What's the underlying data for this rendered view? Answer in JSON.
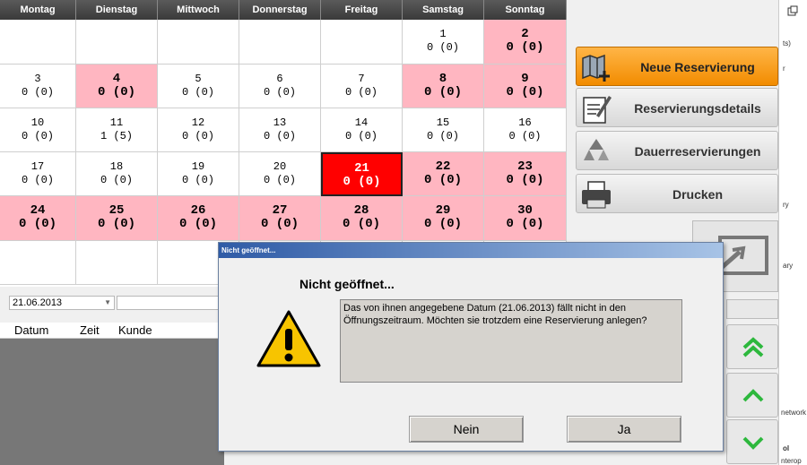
{
  "calendar": {
    "weekdays": [
      "Montag",
      "Dienstag",
      "Mittwoch",
      "Donnerstag",
      "Freitag",
      "Samstag",
      "Sonntag"
    ],
    "weeks": [
      [
        null,
        null,
        null,
        null,
        null,
        {
          "day": "1",
          "count": "0 (0)"
        },
        {
          "day": "2",
          "count": "0 (0)",
          "weekend": true
        }
      ],
      [
        {
          "day": "3",
          "count": "0 (0)"
        },
        {
          "day": "4",
          "count": "0 (0)",
          "weekend": true
        },
        {
          "day": "5",
          "count": "0 (0)"
        },
        {
          "day": "6",
          "count": "0 (0)"
        },
        {
          "day": "7",
          "count": "0 (0)"
        },
        {
          "day": "8",
          "count": "0 (0)",
          "weekend": true
        },
        {
          "day": "9",
          "count": "0 (0)",
          "weekend": true
        }
      ],
      [
        {
          "day": "10",
          "count": "0 (0)"
        },
        {
          "day": "11",
          "count": "1 (5)"
        },
        {
          "day": "12",
          "count": "0 (0)"
        },
        {
          "day": "13",
          "count": "0 (0)"
        },
        {
          "day": "14",
          "count": "0 (0)"
        },
        {
          "day": "15",
          "count": "0 (0)"
        },
        {
          "day": "16",
          "count": "0 (0)"
        }
      ],
      [
        {
          "day": "17",
          "count": "0 (0)"
        },
        {
          "day": "18",
          "count": "0 (0)"
        },
        {
          "day": "19",
          "count": "0 (0)"
        },
        {
          "day": "20",
          "count": "0 (0)"
        },
        {
          "day": "21",
          "count": "0 (0)",
          "selected": true
        },
        {
          "day": "22",
          "count": "0 (0)",
          "weekend": true
        },
        {
          "day": "23",
          "count": "0 (0)",
          "weekend": true
        }
      ],
      [
        {
          "day": "24",
          "count": "0 (0)",
          "weekend": true
        },
        {
          "day": "25",
          "count": "0 (0)",
          "weekend": true
        },
        {
          "day": "26",
          "count": "0 (0)",
          "weekend": true
        },
        {
          "day": "27",
          "count": "0 (0)",
          "weekend": true
        },
        {
          "day": "28",
          "count": "0 (0)",
          "weekend": true
        },
        {
          "day": "29",
          "count": "0 (0)",
          "weekend": true
        },
        {
          "day": "30",
          "count": "0 (0)",
          "weekend": true
        }
      ],
      [
        null,
        null,
        null,
        null,
        null,
        null,
        null
      ]
    ]
  },
  "datebar": {
    "date_value": "21.06.2013"
  },
  "list": {
    "col_date": "Datum",
    "col_time": "Zeit",
    "col_customer": "Kunde"
  },
  "sidebar": {
    "new_reservation": "Neue Reservierung",
    "details": "Reservierungsdetails",
    "recurring": "Dauerreservierungen",
    "print": "Drucken"
  },
  "rightpane": {
    "t1": "ts)",
    "t2": "r",
    "t3": "ry",
    "t4": "ary",
    "t5": "network",
    "t6": "ol",
    "t7": "nterop"
  },
  "dialog": {
    "title": "Nicht geöffnet...",
    "heading": "Nicht geöffnet...",
    "message": "Das von ihnen angegebene Datum (21.06.2013) fällt nicht in den Öffnungszeitraum. Möchten sie trotzdem eine Reservierung anlegen?",
    "no_label": "Nein",
    "yes_label": "Ja"
  },
  "colors": {
    "weekend": "#ffb6c1",
    "selected": "#ff0000",
    "accent": "#f28c00"
  }
}
